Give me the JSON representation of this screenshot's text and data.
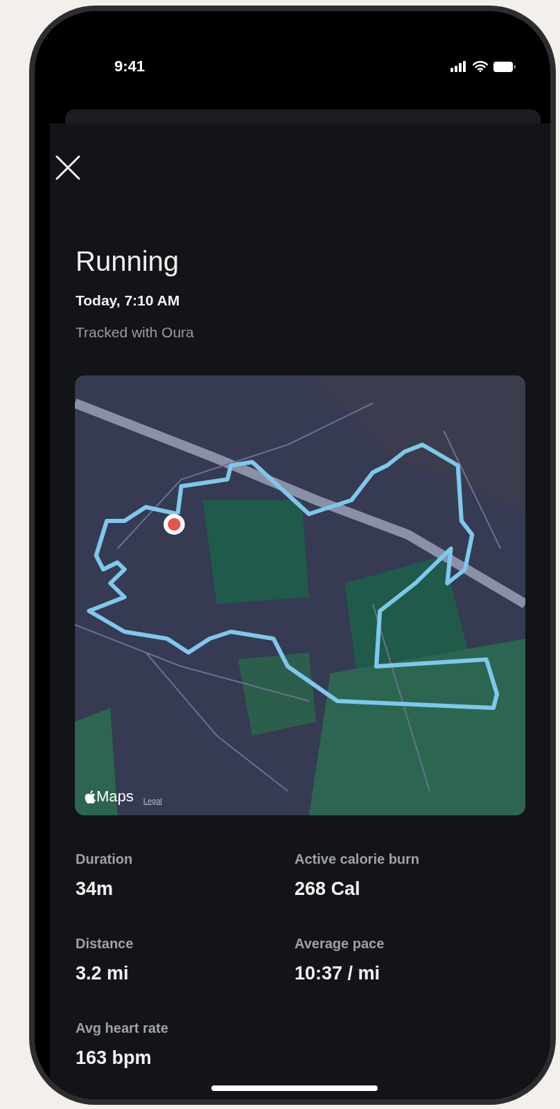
{
  "status_bar": {
    "time": "9:41"
  },
  "workout": {
    "title": "Running",
    "time": "Today, 7:10 AM",
    "source": "Tracked with Oura"
  },
  "map": {
    "attribution": "Maps",
    "legal_link": "Legal"
  },
  "stats": [
    {
      "label": "Duration",
      "value": "34m"
    },
    {
      "label": "Active calorie burn",
      "value": "268 Cal"
    },
    {
      "label": "Distance",
      "value": "3.2 mi"
    },
    {
      "label": "Average pace",
      "value": "10:37 / mi"
    },
    {
      "label": "Avg heart rate",
      "value": "163 bpm"
    }
  ]
}
